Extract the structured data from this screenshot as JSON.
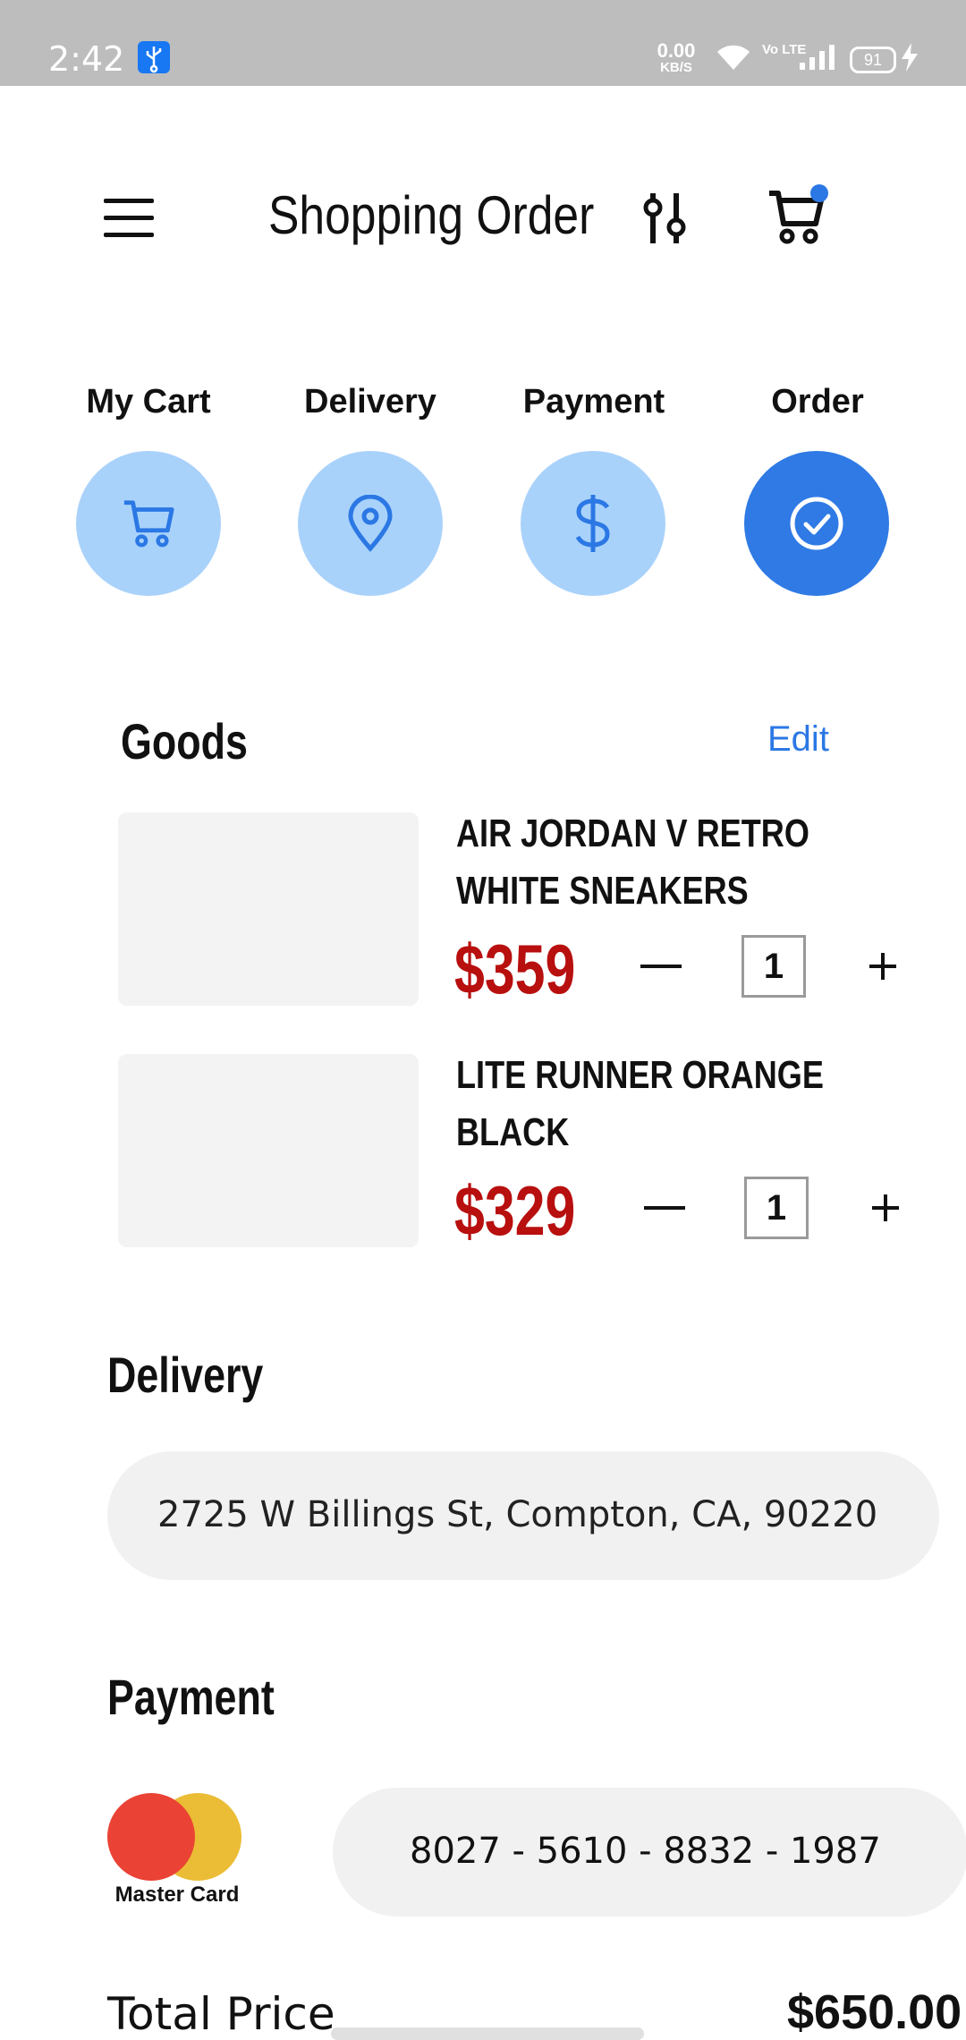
{
  "status_bar": {
    "time": "2:42",
    "net_speed_value": "0.00",
    "net_speed_unit": "KB/S",
    "volte": "Vo LTE",
    "battery": "91"
  },
  "header": {
    "title": "Shopping Order"
  },
  "steps": [
    {
      "label": "My Cart",
      "icon": "cart-icon",
      "active": false
    },
    {
      "label": "Delivery",
      "icon": "location-pin-icon",
      "active": false
    },
    {
      "label": "Payment",
      "icon": "dollar-icon",
      "active": false
    },
    {
      "label": "Order",
      "icon": "check-circle-icon",
      "active": true
    }
  ],
  "goods": {
    "title": "Goods",
    "edit_label": "Edit",
    "items": [
      {
        "name_line1": "AIR JORDAN V RETRO",
        "name_line2": "WHITE SNEAKERS",
        "price": "$359",
        "quantity": "1"
      },
      {
        "name_line1": "LITE RUNNER ORANGE",
        "name_line2": "BLACK",
        "price": "$329",
        "quantity": "1"
      }
    ]
  },
  "delivery": {
    "title": "Delivery",
    "address": "2725 W Billings St, Compton, CA, 90220"
  },
  "payment": {
    "title": "Payment",
    "card_brand": "Master Card",
    "card_number": "8027 - 5610 - 8832 - 1987"
  },
  "total": {
    "label": "Total Price",
    "value": "$650.00"
  },
  "colors": {
    "accent": "#2f7ae5",
    "step_inactive": "#a9d2fb",
    "price": "#b80f0f",
    "status_bar": "#bdbdbd"
  }
}
